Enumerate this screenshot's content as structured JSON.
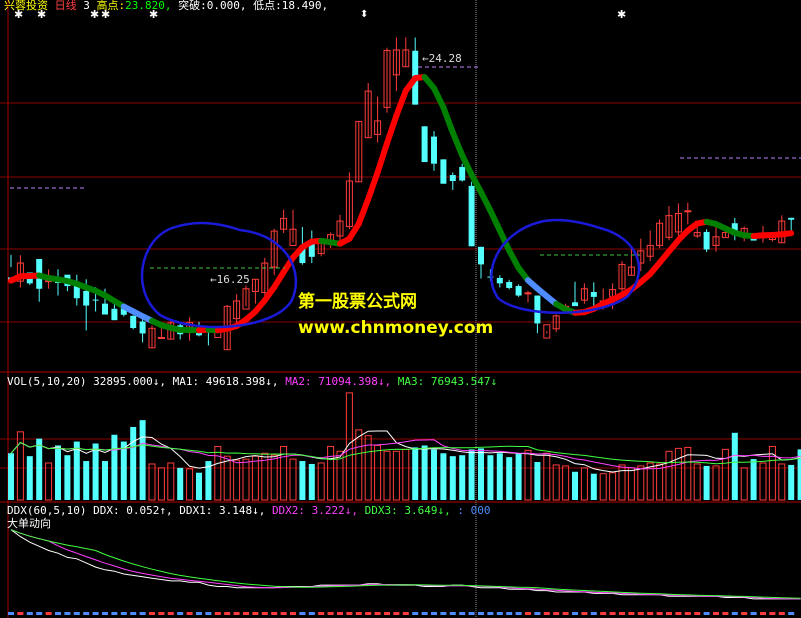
{
  "main_header": {
    "stock_name": "兴蓉投资",
    "period": "日线",
    "count": "3",
    "high_label": "高点:",
    "high_value": "23.820,",
    "break_label": "突破:",
    "break_value": "0.000,",
    "low_label": "低点:",
    "low_value": "18.490,"
  },
  "price_labels": {
    "peak": "24.28",
    "trough": "16.25"
  },
  "watermark": {
    "title": "第一股票公式网",
    "url": "www.chnmoney.com"
  },
  "vol_header": {
    "name": "VOL(5,10,20)",
    "vol": "32895.000↓,",
    "ma1": "MA1: 49618.398↓,",
    "ma2": "MA2: 71094.398↓,",
    "ma3": "MA3: 76943.547↓"
  },
  "ddx_header": {
    "name": "DDX(60,5,10)",
    "ddx": "DDX: 0.052↑,",
    "ddx1": "DDX1: 3.148↓,",
    "ddx2": "DDX2: 3.222↓,",
    "ddx3": "DDX3: 3.649↓,",
    "extra": ": 000",
    "sub_label": "大单动向"
  },
  "markers": {
    "star": "✱",
    "arrow": "⬍"
  },
  "colors": {
    "up": "#ff3c3c",
    "down": "#54ffff",
    "ma_up": "#ff0000",
    "ma_down": "#008000",
    "ma_blue": "#4f8cff",
    "circle": "#1a1ad8",
    "grid": "#8b0000",
    "watermark": "#ffff00",
    "ma1": "#ffffff",
    "ma2": "#ff40ff",
    "ma3": "#40ff40"
  },
  "candles": [
    [
      15.42,
      15.3,
      16.25,
      15.8
    ],
    [
      15.28,
      15.95,
      15.05,
      16.24
    ],
    [
      15.6,
      15.2,
      15.14,
      15.36
    ],
    [
      16.1,
      15.0,
      14.52,
      16.06
    ],
    [
      15.3,
      15.3,
      15.0,
      15.72
    ],
    [
      15.25,
      15.22,
      14.75,
      15.72
    ],
    [
      15.52,
      15.1,
      14.91,
      15.38
    ],
    [
      15.1,
      14.65,
      14.38,
      15.52
    ],
    [
      14.92,
      14.38,
      13.46,
      15.35
    ],
    [
      14.6,
      14.58,
      14.16,
      15.06
    ],
    [
      14.45,
      14.05,
      14.05,
      15.0
    ],
    [
      14.26,
      13.84,
      13.84,
      14.59
    ],
    [
      14.35,
      14.04,
      13.98,
      14.42
    ],
    [
      14.0,
      13.55,
      13.5,
      14.02
    ],
    [
      13.79,
      13.35,
      13.02,
      13.93
    ],
    [
      12.82,
      13.54,
      12.82,
      13.65
    ],
    [
      13.2,
      13.2,
      13.2,
      13.54
    ],
    [
      13.14,
      13.74,
      13.14,
      13.88
    ],
    [
      13.65,
      13.32,
      13.13,
      13.78
    ],
    [
      13.58,
      13.75,
      13.08,
      13.95
    ],
    [
      13.55,
      13.28,
      13.24,
      13.78
    ],
    [
      13.5,
      13.42,
      12.91,
      13.6
    ],
    [
      13.2,
      13.4,
      13.2,
      13.2
    ],
    [
      12.75,
      14.35,
      12.74,
      14.4
    ],
    [
      13.9,
      14.55,
      13.73,
      14.8
    ],
    [
      14.25,
      15.0,
      14.35,
      15.12
    ],
    [
      14.9,
      15.35,
      14.45,
      15.35
    ],
    [
      14.86,
      15.95,
      14.45,
      16.14
    ],
    [
      15.8,
      17.13,
      15.5,
      17.22
    ],
    [
      17.2,
      17.6,
      17.06,
      17.92
    ],
    [
      16.6,
      17.2,
      16.71,
      17.92
    ],
    [
      16.5,
      15.95,
      15.89,
      17.28
    ],
    [
      16.7,
      16.18,
      15.95,
      17.15
    ],
    [
      16.3,
      16.7,
      16.2,
      16.8
    ],
    [
      16.7,
      17.0,
      16.5,
      17.08
    ],
    [
      16.95,
      17.5,
      16.7,
      17.73
    ],
    [
      17.3,
      18.98,
      17.2,
      19.3
    ],
    [
      18.95,
      21.18,
      18.95,
      21.2
    ],
    [
      20.58,
      22.3,
      20.58,
      22.6
    ],
    [
      20.7,
      21.2,
      20.4,
      22.1
    ],
    [
      21.7,
      23.8,
      21.5,
      23.9
    ],
    [
      22.9,
      23.82,
      22.3,
      24.28
    ],
    [
      23.2,
      23.82,
      23.2,
      24.28
    ],
    [
      23.79,
      21.8,
      21.8,
      24.28
    ],
    [
      21.0,
      19.68,
      19.68,
      21.0
    ],
    [
      20.62,
      19.62,
      19.36,
      20.82
    ],
    [
      19.78,
      18.88,
      18.88,
      19.78
    ],
    [
      19.2,
      18.98,
      18.65,
      19.3
    ],
    [
      19.5,
      19.0,
      18.96,
      19.62
    ],
    [
      18.8,
      16.57,
      16.57,
      18.95
    ],
    [
      16.55,
      15.9,
      15.38,
      16.55
    ],
    [
      15.45,
      15.44,
      15.3,
      15.72
    ],
    [
      15.4,
      15.2,
      15.05,
      15.5
    ],
    [
      15.25,
      15.03,
      14.98,
      15.33
    ],
    [
      15.1,
      14.75,
      14.7,
      15.16
    ],
    [
      14.83,
      14.85,
      14.5,
      14.92
    ],
    [
      14.75,
      13.72,
      13.36,
      14.75
    ],
    [
      13.18,
      13.67,
      13.43,
      13.35
    ],
    [
      13.52,
      14.0,
      13.4,
      14.05
    ],
    [
      14.28,
      14.35,
      14.08,
      14.45
    ],
    [
      14.5,
      14.36,
      14.43,
      15.26
    ],
    [
      14.58,
      15.0,
      14.45,
      15.2
    ],
    [
      14.88,
      14.7,
      14.35,
      15.24
    ],
    [
      14.32,
      14.55,
      14.23,
      15.01
    ],
    [
      14.7,
      14.97,
      14.25,
      15.2
    ],
    [
      15.0,
      15.9,
      14.9,
      16.02
    ],
    [
      15.5,
      15.8,
      15.5,
      16.55
    ],
    [
      15.95,
      16.4,
      15.65,
      16.85
    ],
    [
      16.2,
      16.6,
      16.02,
      17.15
    ],
    [
      16.6,
      17.42,
      16.5,
      17.56
    ],
    [
      16.9,
      17.7,
      16.79,
      18.05
    ],
    [
      17.1,
      17.78,
      16.84,
      18.15
    ],
    [
      17.88,
      17.88,
      17.38,
      18.18
    ],
    [
      16.95,
      17.08,
      16.88,
      17.3
    ],
    [
      17.1,
      16.45,
      16.36,
      17.2
    ],
    [
      16.6,
      16.92,
      16.37,
      17.3
    ],
    [
      16.89,
      17.08,
      16.89,
      17.3
    ],
    [
      17.42,
      16.98,
      16.79,
      17.62
    ],
    [
      17.0,
      17.23,
      16.75,
      17.3
    ],
    [
      16.98,
      16.78,
      16.78,
      17.06
    ],
    [
      16.9,
      16.92,
      16.7,
      17.32
    ],
    [
      16.82,
      16.9,
      16.74,
      16.88
    ],
    [
      16.7,
      17.5,
      16.7,
      17.71
    ],
    [
      17.62,
      17.55,
      17.05,
      17.62
    ]
  ],
  "volumes": [
    48,
    70,
    45,
    63,
    38,
    56,
    46,
    60,
    40,
    58,
    40,
    67,
    60,
    75,
    82,
    37,
    33,
    38,
    33,
    32,
    28,
    40,
    55,
    45,
    41,
    42,
    45,
    48,
    46,
    55,
    42,
    40,
    37,
    38,
    55,
    50,
    110,
    72,
    66,
    56,
    50,
    50,
    52,
    54,
    56,
    52,
    48,
    45,
    46,
    52,
    53,
    46,
    48,
    44,
    48,
    51,
    39,
    48,
    36,
    35,
    29,
    33,
    27,
    27,
    28,
    36,
    33,
    35,
    38,
    37,
    50,
    53,
    54,
    37,
    35,
    35,
    52,
    69,
    33,
    42,
    38,
    55,
    37,
    36,
    52
  ],
  "ddx": [
    7.8,
    7.3,
    6.9,
    6.6,
    6.3,
    6.1,
    5.8,
    5.7,
    5.4,
    5.1,
    4.9,
    4.8,
    4.6,
    4.5,
    4.4,
    4.3,
    4.2,
    4.1,
    4.1,
    4.0,
    4.0,
    3.8,
    3.7,
    3.7,
    3.6,
    3.6,
    3.6,
    3.6,
    3.6,
    3.7,
    3.7,
    3.7,
    3.7,
    3.8,
    3.8,
    3.8,
    3.8,
    3.8,
    3.9,
    3.9,
    3.8,
    3.8,
    3.8,
    3.8,
    3.7,
    3.7,
    3.7,
    3.8,
    3.8,
    3.7,
    3.6,
    3.6,
    3.6,
    3.5,
    3.5,
    3.5,
    3.4,
    3.4,
    3.3,
    3.3,
    3.3,
    3.3,
    3.2,
    3.2,
    3.2,
    3.1,
    3.1,
    3.1,
    3.1,
    3.1,
    3.0,
    3.0,
    3.0,
    3.0,
    3.0,
    3.0,
    2.9,
    2.9,
    2.9,
    2.8,
    2.8,
    2.8,
    2.8,
    2.8,
    2.8
  ]
}
